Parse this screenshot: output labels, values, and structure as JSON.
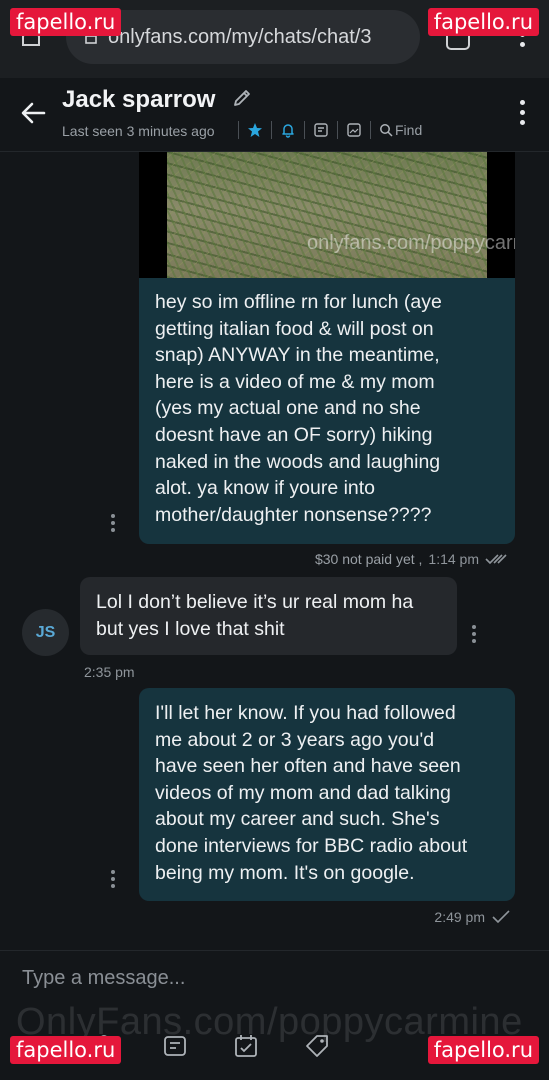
{
  "browser": {
    "url": "onlyfans.com/my/chats/chat/3"
  },
  "header": {
    "name": "Jack sparrow",
    "last_seen": "Last seen 3 minutes ago",
    "find_label": "Find"
  },
  "media": {
    "watermark": "onlyfans.com/poppycarmine"
  },
  "messages": [
    {
      "direction": "out",
      "text": "hey so im offline rn for lunch (aye\ngetting italian food & will post on\nsnap) ANYWAY in the meantime,\nhere is a video of me & my mom\n(yes my actual one and no she\ndoesnt have an OF sorry) hiking\nnaked in the woods and laughing\nalot. ya know if youre into\nmother/daughter nonsense????",
      "price": "$30 not paid yet ,",
      "time": "1:14 pm"
    },
    {
      "direction": "in",
      "avatar": "JS",
      "text": "Lol I don’t believe it’s ur real mom ha\nbut yes I love that shit",
      "time": "2:35 pm"
    },
    {
      "direction": "out",
      "text": "I'll let her know. If you had followed\nme about 2 or 3 years ago you'd\nhave seen her often and have seen\nvideos of my mom and dad talking\nabout my career and such. She's\ndone interviews for BBC radio about\nbeing my mom. It's on google.",
      "time": "2:49 pm"
    }
  ],
  "composer": {
    "placeholder": "Type a message...",
    "watermark": "OnlyFans.com/poppycarmine"
  },
  "overlay": {
    "badge_text": "fapello.ru"
  },
  "colors": {
    "accent": "#2aa6de",
    "outgoing_bubble": "#16343e",
    "incoming_bubble": "#25282c",
    "badge": "#e5173b"
  }
}
